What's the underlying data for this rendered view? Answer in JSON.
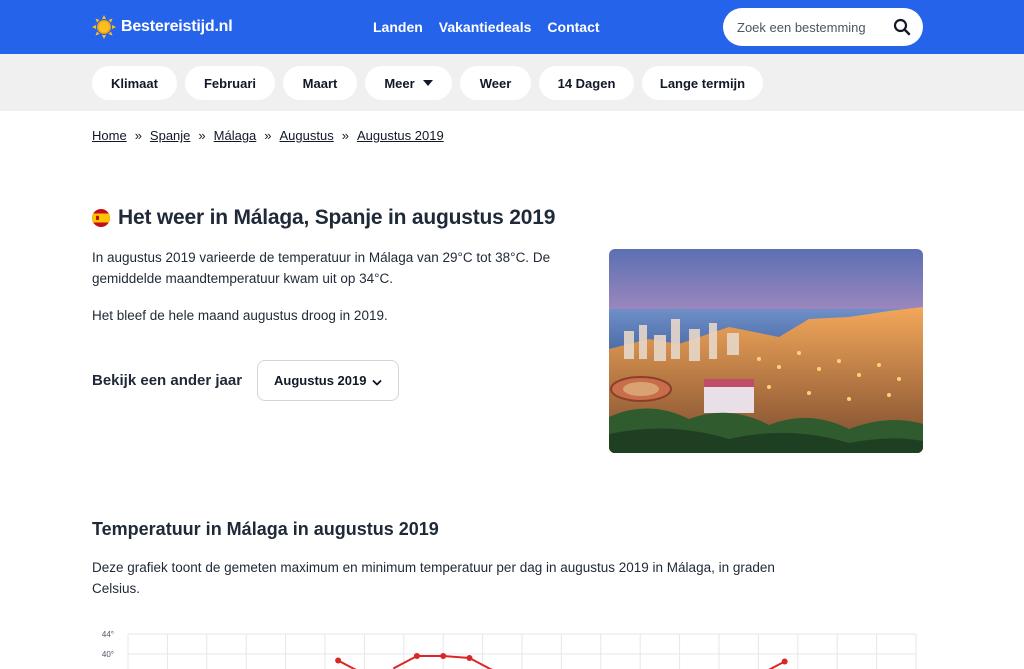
{
  "header": {
    "logo_text": "Bestereistijd.nl",
    "nav": [
      "Landen",
      "Vakantiedeals",
      "Contact"
    ],
    "search_placeholder": "Zoek een bestemming",
    "brand_color": "#2563eb"
  },
  "subnav": {
    "items": [
      "Klimaat",
      "Februari",
      "Maart",
      "Meer",
      "Weer",
      "14 Dagen",
      "Lange termijn"
    ]
  },
  "breadcrumb": [
    "Home",
    "Spanje",
    "Málaga",
    "Augustus",
    "Augustus 2019"
  ],
  "breadcrumb_separator": "»",
  "main": {
    "title": "Het weer in Málaga, Spanje in augustus 2019",
    "paragraph1": "In augustus 2019 varieerde de temperatuur in Málaga van 29°C tot 38°C. De gemiddelde maandtemperatuur kwam uit op 34°C.",
    "paragraph2": "Het bleef de hele maand augustus droog in 2019.",
    "year_label": "Bekijk een ander jaar",
    "year_select_value": "Augustus 2019",
    "image_subject": "Málaga cityscape at dusk"
  },
  "temperature": {
    "title": "Temperatuur in Málaga in augustus 2019",
    "description": "Deze grafiek toont de gemeten maximum en minimum temperatuur per dag in augustus 2019 in Málaga, in graden Celsius."
  },
  "chart_data": {
    "type": "line",
    "ytick_labels": [
      "44°",
      "40°"
    ],
    "ylim": [
      36,
      44
    ],
    "grid": true,
    "series": [
      {
        "color": "#dc2626",
        "points": [
          [
            9,
            38.7
          ],
          [
            12,
            39.6
          ],
          [
            13,
            39.6
          ],
          [
            14,
            39.2
          ],
          [
            26,
            38.5
          ]
        ]
      }
    ]
  }
}
